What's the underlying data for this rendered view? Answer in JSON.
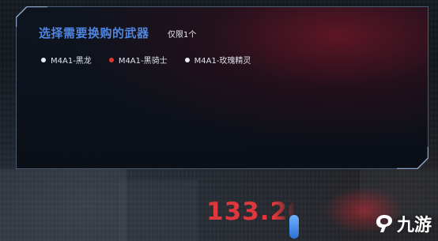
{
  "panel": {
    "title": "选择需要换购的武器",
    "limit_note": "仅限1个",
    "options": [
      {
        "label": "M4A1-黑龙",
        "selected": false
      },
      {
        "label": "M4A1-黑骑士",
        "selected": true
      },
      {
        "label": "M4A1-玫瑰精灵",
        "selected": false
      }
    ]
  },
  "price": "133.20",
  "watermark": {
    "text": "九游",
    "icon": "nine-game-logo"
  },
  "colors": {
    "title": "#4f86e0",
    "selected_dot": "#e0362f",
    "unselected_dot": "#e8ecf2",
    "price": "#e0383a",
    "panel_border": "#4a5a70"
  }
}
